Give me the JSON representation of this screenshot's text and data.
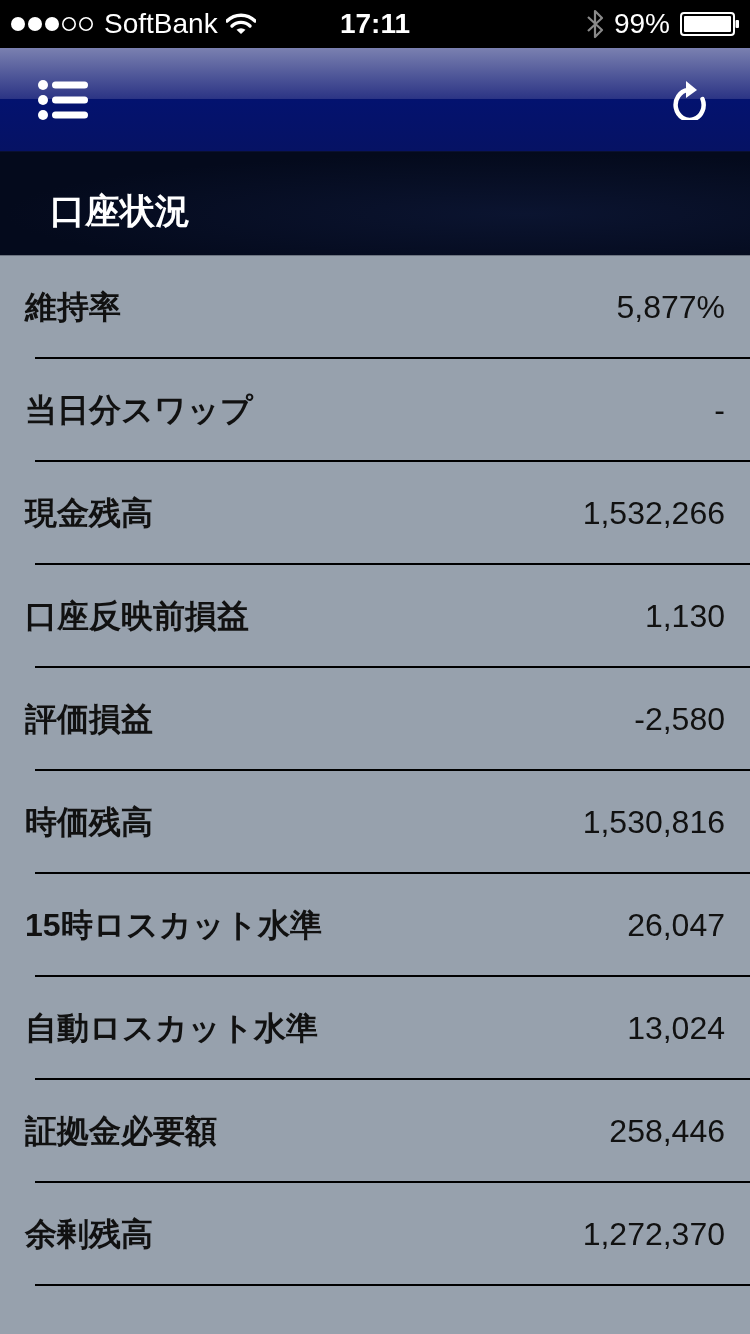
{
  "status_bar": {
    "carrier": "SoftBank",
    "time": "17:11",
    "battery": "99%"
  },
  "header": {
    "title": "口座状況"
  },
  "rows": [
    {
      "label": "維持率",
      "value": "5,877%"
    },
    {
      "label": "当日分スワップ",
      "value": "-"
    },
    {
      "label": "現金残高",
      "value": "1,532,266"
    },
    {
      "label": "口座反映前損益",
      "value": "1,130"
    },
    {
      "label": "評価損益",
      "value": "-2,580"
    },
    {
      "label": "時価残高",
      "value": "1,530,816"
    },
    {
      "label": "15時ロスカット水準",
      "value": "26,047"
    },
    {
      "label": "自動ロスカット水準",
      "value": "13,024"
    },
    {
      "label": "証拠金必要額",
      "value": "258,446"
    },
    {
      "label": "余剰残高",
      "value": "1,272,370"
    }
  ]
}
